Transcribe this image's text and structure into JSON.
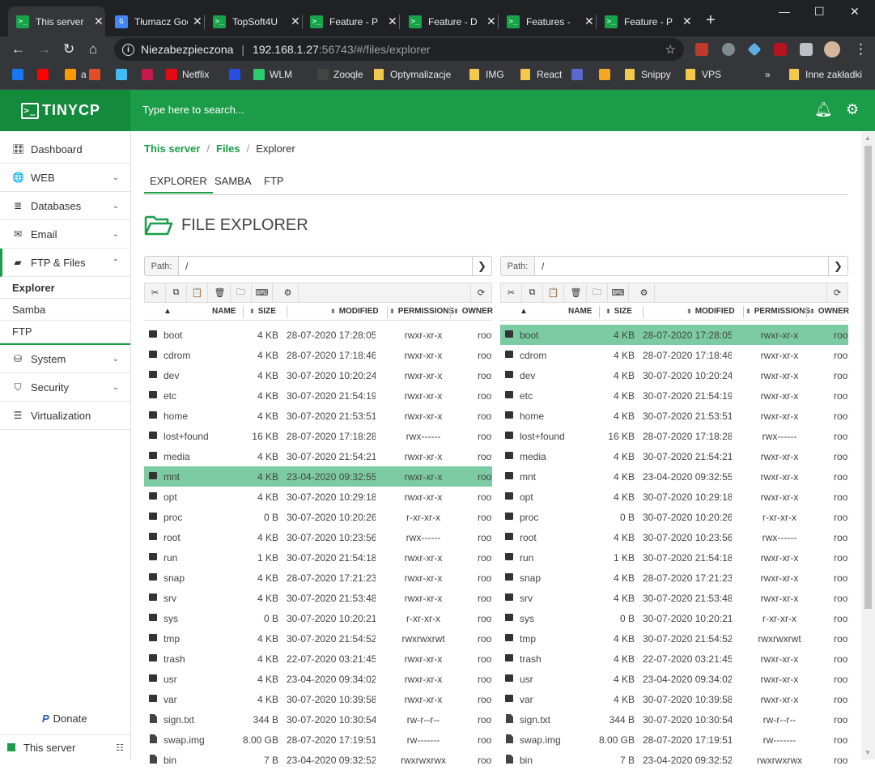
{
  "browser": {
    "tabs": [
      {
        "title": "This server",
        "close": "✕",
        "fav": ">_"
      },
      {
        "title": "Tłumacz Google",
        "close": "✕",
        "fav": "G"
      },
      {
        "title": "TopSoft4U",
        "close": "✕",
        "fav": ">_"
      },
      {
        "title": "Feature - P",
        "close": "✕",
        "fav": ">_"
      },
      {
        "title": "Feature - D",
        "close": "✕",
        "fav": ">_"
      },
      {
        "title": "Features -",
        "close": "✕",
        "fav": ">_"
      },
      {
        "title": "Feature - P",
        "close": "✕",
        "fav": ">_"
      }
    ],
    "new_tab": "+",
    "window": {
      "minimize": "—",
      "maximize": "☐",
      "close": "✕"
    },
    "security_label": "Niezabezpieczona",
    "url_host": "192.168.1.27",
    "url_rest": ":56743/#/files/explorer",
    "bookmarks": [
      {
        "label": "",
        "color": "#1877f2"
      },
      {
        "label": "",
        "color": "#ff0000"
      },
      {
        "label": "a",
        "color": "#ff9900"
      },
      {
        "label": "",
        "color": "#e44d26"
      },
      {
        "label": "",
        "color": "#41bdf5"
      },
      {
        "label": "",
        "color": "#c51a4a"
      },
      {
        "label": "Netflix",
        "color": "#e50914"
      },
      {
        "label": "",
        "color": "#264de4"
      },
      {
        "label": "WLM",
        "color": "#2ecc71"
      },
      {
        "label": "Zooqle",
        "color": "#444444"
      },
      {
        "label": "Optymalizacje",
        "folder": true
      },
      {
        "label": "IMG",
        "folder": true
      },
      {
        "label": "React",
        "folder": true
      },
      {
        "label": "",
        "color": "#5a6acf"
      },
      {
        "label": "",
        "color": "#f5a623"
      },
      {
        "label": "Snippy",
        "folder": true
      },
      {
        "label": "VPS",
        "folder": true
      }
    ],
    "more": "»",
    "other_bookmarks": "Inne zakładki"
  },
  "app": {
    "logo": "TINYCP",
    "logo_glyph": ">_",
    "search_placeholder": "Type here to search...",
    "bell_icon": "bell-icon",
    "settings_icon": "gears-icon"
  },
  "sidebar": {
    "items": [
      {
        "label": "Dashboard",
        "icon": "🎛",
        "chevron": ""
      },
      {
        "label": "WEB",
        "icon": "🌐",
        "chevron": "⌄"
      },
      {
        "label": "Databases",
        "icon": "≣",
        "chevron": "⌄"
      },
      {
        "label": "Email",
        "icon": "✉",
        "chevron": "⌄"
      },
      {
        "label": "FTP & Files",
        "icon": "▰",
        "chevron": "⌃"
      }
    ],
    "subitems": [
      "Explorer",
      "Samba",
      "FTP"
    ],
    "items2": [
      {
        "label": "System",
        "icon": "⛁",
        "chevron": "⌄"
      },
      {
        "label": "Security",
        "icon": "⛉",
        "chevron": "⌄"
      },
      {
        "label": "Virtualization",
        "icon": "☰",
        "chevron": ""
      }
    ],
    "donate": "Donate",
    "donate_glyph": "P",
    "server": "This server"
  },
  "main": {
    "breadcrumb": [
      "This server",
      "Files",
      "Explorer"
    ],
    "breadcrumb_sep": "/",
    "tabs": [
      "EXPLORER",
      "SAMBA",
      "FTP"
    ],
    "title": "FILE EXPLORER"
  },
  "explorer": {
    "path_label": "Path:",
    "path_value": "/",
    "go": "❯",
    "toolbar": [
      "✂",
      "⧉",
      "📋",
      "🗑",
      "🗀",
      "⌨",
      "⚙"
    ],
    "refresh": "⟳",
    "columns": {
      "sort": "▲",
      "arrows": "⬍",
      "name": "NAME",
      "size": "SIZE",
      "modified": "MODIFIED",
      "permissions": "PERMISSIONS",
      "owner": "OWNER"
    },
    "left_selected": 7,
    "right_selected": 0,
    "files": [
      {
        "type": "folder",
        "name": "boot",
        "size": "4 KB",
        "modified": "28-07-2020 17:28:05",
        "perm": "rwxr-xr-x",
        "owner": "root"
      },
      {
        "type": "folder",
        "name": "cdrom",
        "size": "4 KB",
        "modified": "28-07-2020 17:18:46",
        "perm": "rwxr-xr-x",
        "owner": "root"
      },
      {
        "type": "folder",
        "name": "dev",
        "size": "4 KB",
        "modified": "30-07-2020 10:20:24",
        "perm": "rwxr-xr-x",
        "owner": "root"
      },
      {
        "type": "folder",
        "name": "etc",
        "size": "4 KB",
        "modified": "30-07-2020 21:54:19",
        "perm": "rwxr-xr-x",
        "owner": "root"
      },
      {
        "type": "folder",
        "name": "home",
        "size": "4 KB",
        "modified": "30-07-2020 21:53:51",
        "perm": "rwxr-xr-x",
        "owner": "root"
      },
      {
        "type": "folder",
        "name": "lost+found",
        "size": "16 KB",
        "modified": "28-07-2020 17:18:28",
        "perm": "rwx------",
        "owner": "root"
      },
      {
        "type": "folder",
        "name": "media",
        "size": "4 KB",
        "modified": "30-07-2020 21:54:21",
        "perm": "rwxr-xr-x",
        "owner": "root"
      },
      {
        "type": "folder",
        "name": "mnt",
        "size": "4 KB",
        "modified": "23-04-2020 09:32:55",
        "perm": "rwxr-xr-x",
        "owner": "root"
      },
      {
        "type": "folder",
        "name": "opt",
        "size": "4 KB",
        "modified": "30-07-2020 10:29:18",
        "perm": "rwxr-xr-x",
        "owner": "root"
      },
      {
        "type": "folder",
        "name": "proc",
        "size": "0 B",
        "modified": "30-07-2020 10:20:26",
        "perm": "r-xr-xr-x",
        "owner": "root"
      },
      {
        "type": "folder",
        "name": "root",
        "size": "4 KB",
        "modified": "30-07-2020 10:23:56",
        "perm": "rwx------",
        "owner": "root"
      },
      {
        "type": "folder",
        "name": "run",
        "size": "1 KB",
        "modified": "30-07-2020 21:54:18",
        "perm": "rwxr-xr-x",
        "owner": "root"
      },
      {
        "type": "folder",
        "name": "snap",
        "size": "4 KB",
        "modified": "28-07-2020 17:21:23",
        "perm": "rwxr-xr-x",
        "owner": "root"
      },
      {
        "type": "folder",
        "name": "srv",
        "size": "4 KB",
        "modified": "30-07-2020 21:53:48",
        "perm": "rwxr-xr-x",
        "owner": "root"
      },
      {
        "type": "folder",
        "name": "sys",
        "size": "0 B",
        "modified": "30-07-2020 10:20:21",
        "perm": "r-xr-xr-x",
        "owner": "root"
      },
      {
        "type": "folder",
        "name": "tmp",
        "size": "4 KB",
        "modified": "30-07-2020 21:54:52",
        "perm": "rwxrwxrwt",
        "owner": "root"
      },
      {
        "type": "folder",
        "name": "trash",
        "size": "4 KB",
        "modified": "22-07-2020 03:21:45",
        "perm": "rwxr-xr-x",
        "owner": "root"
      },
      {
        "type": "folder",
        "name": "usr",
        "size": "4 KB",
        "modified": "23-04-2020 09:34:02",
        "perm": "rwxr-xr-x",
        "owner": "root"
      },
      {
        "type": "folder",
        "name": "var",
        "size": "4 KB",
        "modified": "30-07-2020 10:39:58",
        "perm": "rwxr-xr-x",
        "owner": "root"
      },
      {
        "type": "file",
        "name": "sign.txt",
        "size": "344 B",
        "modified": "30-07-2020 10:30:54",
        "perm": "rw-r--r--",
        "owner": "root"
      },
      {
        "type": "file",
        "name": "swap.img",
        "size": "8.00 GB",
        "modified": "28-07-2020 17:19:51",
        "perm": "rw-------",
        "owner": "root"
      },
      {
        "type": "link",
        "name": "bin",
        "size": "7 B",
        "modified": "23-04-2020 09:32:52",
        "perm": "rwxrwxrwx",
        "owner": "root"
      }
    ]
  },
  "colors": {
    "brand": "#1a9c48",
    "selected_row": "#7ccba3"
  }
}
